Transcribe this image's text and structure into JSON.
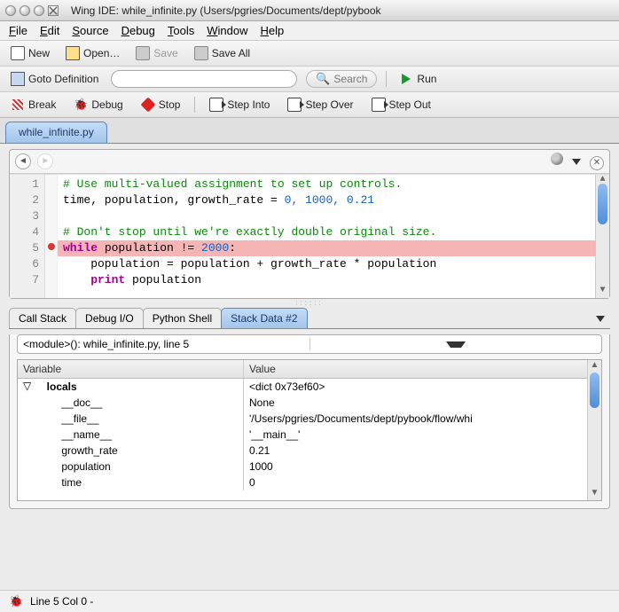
{
  "window": {
    "title": "Wing IDE: while_infinite.py (Users/pgries/Documents/dept/pybook"
  },
  "menubar": {
    "file": "File",
    "edit": "Edit",
    "source": "Source",
    "debug": "Debug",
    "tools": "Tools",
    "window": "Window",
    "help": "Help"
  },
  "toolbar": {
    "new": "New",
    "open": "Open…",
    "save": "Save",
    "save_all": "Save All",
    "goto_def": "Goto Definition",
    "search": "Search",
    "run": "Run",
    "break": "Break",
    "debug": "Debug",
    "stop": "Stop",
    "step_into": "Step Into",
    "step_over": "Step Over",
    "step_out": "Step Out"
  },
  "editor_tab": {
    "label": "while_infinite.py"
  },
  "code": {
    "lines": [
      {
        "n": "1",
        "cls": "c-comment",
        "text": "# Use multi-valued assignment to set up controls."
      },
      {
        "n": "2",
        "cls": "",
        "text": "time, population, growth_rate = ",
        "tail_cls": "c-num",
        "tail": "0, 1000, 0.21"
      },
      {
        "n": "3",
        "cls": "",
        "text": ""
      },
      {
        "n": "4",
        "cls": "c-comment",
        "text": "# Don't stop until we're exactly double original size."
      },
      {
        "n": "5",
        "cls": "hl",
        "kw": "while",
        "mid": " population != ",
        "num": "2000",
        "end": ":"
      },
      {
        "n": "6",
        "cls": "",
        "text": "    population = population + growth_rate * population"
      },
      {
        "n": "7",
        "cls": "",
        "kw": "    print",
        "mid": " population"
      }
    ],
    "breakpoint_line": "5"
  },
  "panel_tabs": {
    "call_stack": "Call Stack",
    "debug_io": "Debug I/O",
    "python_shell": "Python Shell",
    "stack_data": "Stack Data #2"
  },
  "frame_combo": "<module>(): while_infinite.py, line 5",
  "vars_header": {
    "var": "Variable",
    "val": "Value"
  },
  "vars": [
    {
      "indent": 0,
      "exp": "▽",
      "name": "locals",
      "bold": true,
      "value": "<dict 0x73ef60>"
    },
    {
      "indent": 1,
      "name": "__doc__",
      "value": "None"
    },
    {
      "indent": 1,
      "name": "__file__",
      "value": "'/Users/pgries/Documents/dept/pybook/flow/whi"
    },
    {
      "indent": 1,
      "name": "__name__",
      "value": "'__main__'"
    },
    {
      "indent": 1,
      "name": "growth_rate",
      "value": "0.21"
    },
    {
      "indent": 1,
      "name": "population",
      "value": "1000"
    },
    {
      "indent": 1,
      "name": "time",
      "value": "0"
    }
  ],
  "status": "Line 5 Col 0 -"
}
